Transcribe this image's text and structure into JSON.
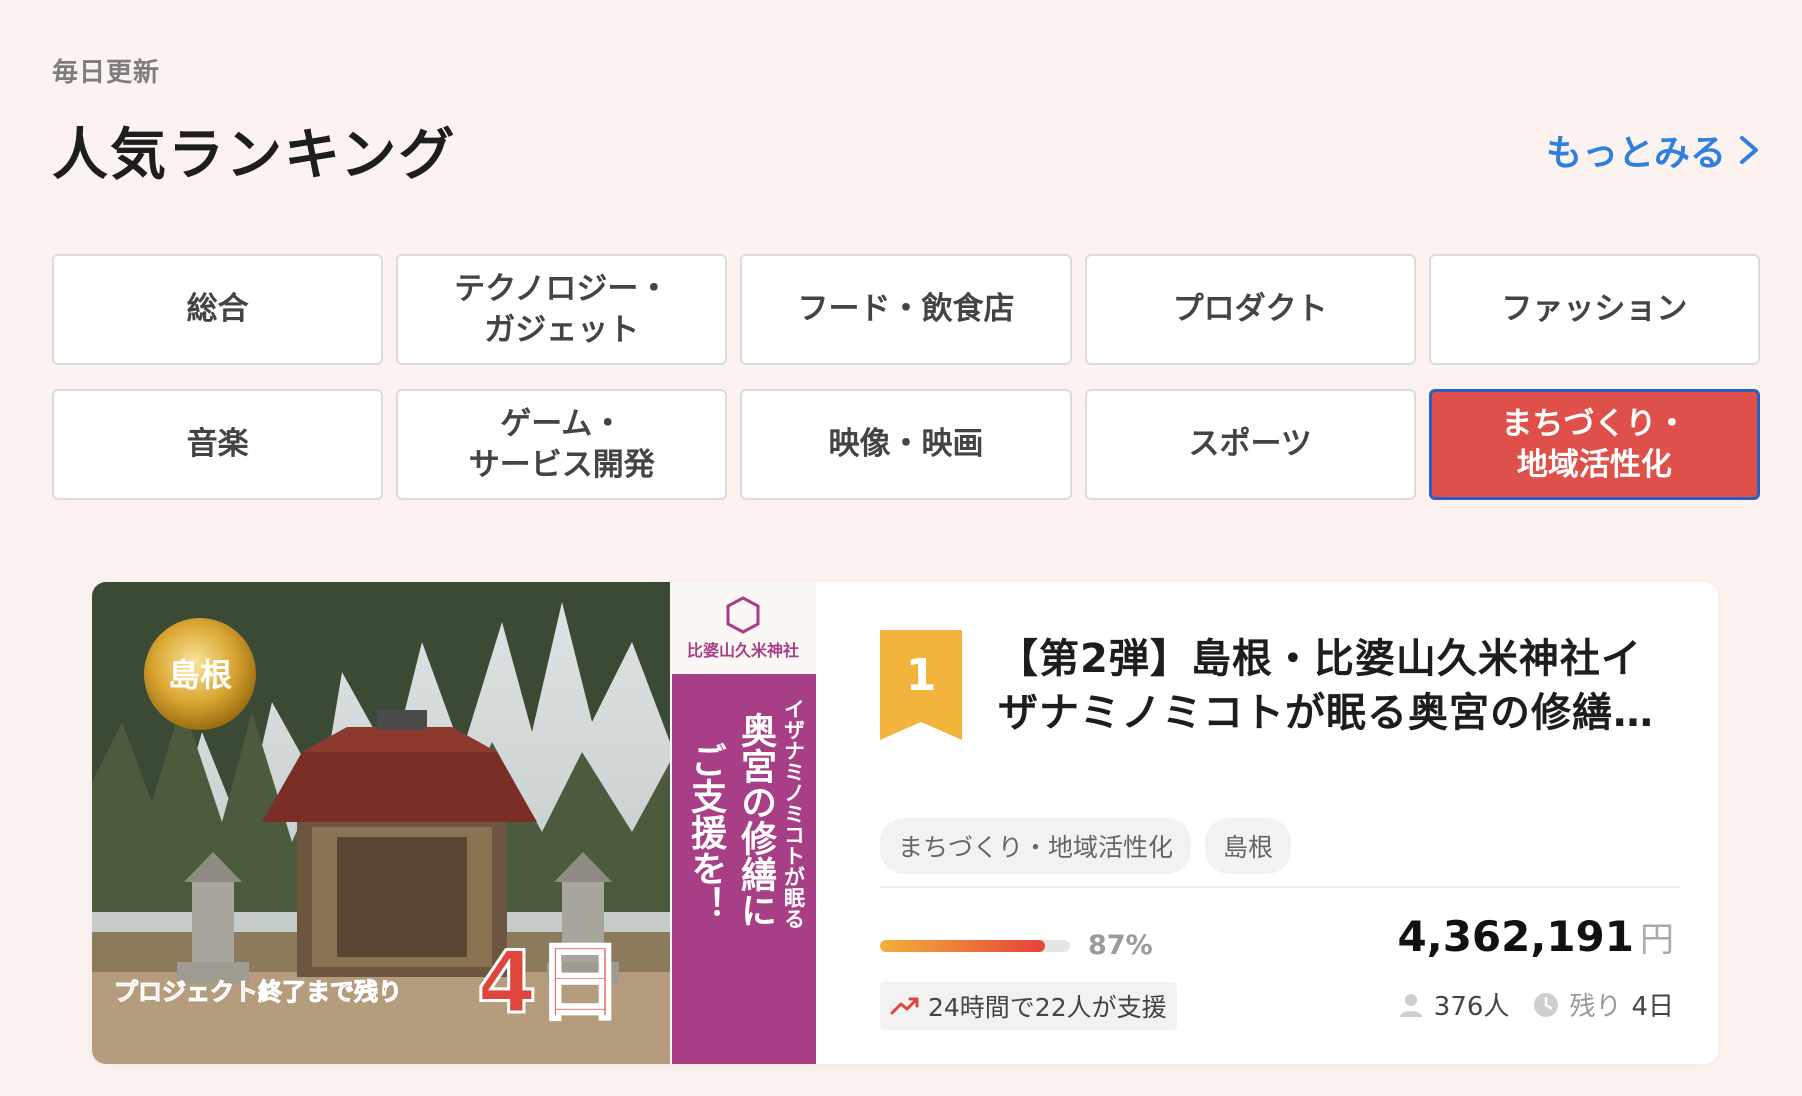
{
  "header": {
    "eyebrow": "毎日更新",
    "title": "人気ランキング",
    "more_label": "もっとみる"
  },
  "categories": [
    {
      "label": "総合",
      "active": false
    },
    {
      "label": "テクノロジー・\nガジェット",
      "active": false
    },
    {
      "label": "フード・飲食店",
      "active": false
    },
    {
      "label": "プロダクト",
      "active": false
    },
    {
      "label": "ファッション",
      "active": false
    },
    {
      "label": "音楽",
      "active": false
    },
    {
      "label": "ゲーム・\nサービス開発",
      "active": false
    },
    {
      "label": "映像・映画",
      "active": false
    },
    {
      "label": "スポーツ",
      "active": false
    },
    {
      "label": "まちづくり・\n地域活性化",
      "active": true
    }
  ],
  "project": {
    "rank": "1",
    "title": "【第2弾】島根・比婆山久米神社イザナミノミコトが眠る奥宮の修繕…",
    "tags": [
      "まちづくり・地域活性化",
      "島根"
    ],
    "progress_percent": 87,
    "percent_label": "87%",
    "trend_text": "24時間で22人が支援",
    "amount": "4,362,191",
    "currency": "円",
    "supporters": "376人",
    "remaining_label": "残り",
    "remaining_value": "4日",
    "thumbnail": {
      "badge": "島根",
      "shrine_name": "比婆山久米神社",
      "vertical_small": "イザナミノミコトが眠る",
      "vertical_large_1": "奥宮の修繕に",
      "vertical_large_2": "ご支援を！",
      "countdown_text": "プロジェクト終了まで残り",
      "countdown_value": "4日"
    }
  },
  "colors": {
    "background": "#fcf3f1",
    "accent_link": "#2e7fe0",
    "active_category": "#e0504a",
    "active_border": "#2a5fc4",
    "rank_ribbon": "#f2b43c",
    "thumbnail_banner": "#a83e86"
  },
  "icons": {
    "more": "chevron-right-icon",
    "trend": "trending-up-icon",
    "supporters": "user-icon",
    "remaining": "clock-icon"
  }
}
